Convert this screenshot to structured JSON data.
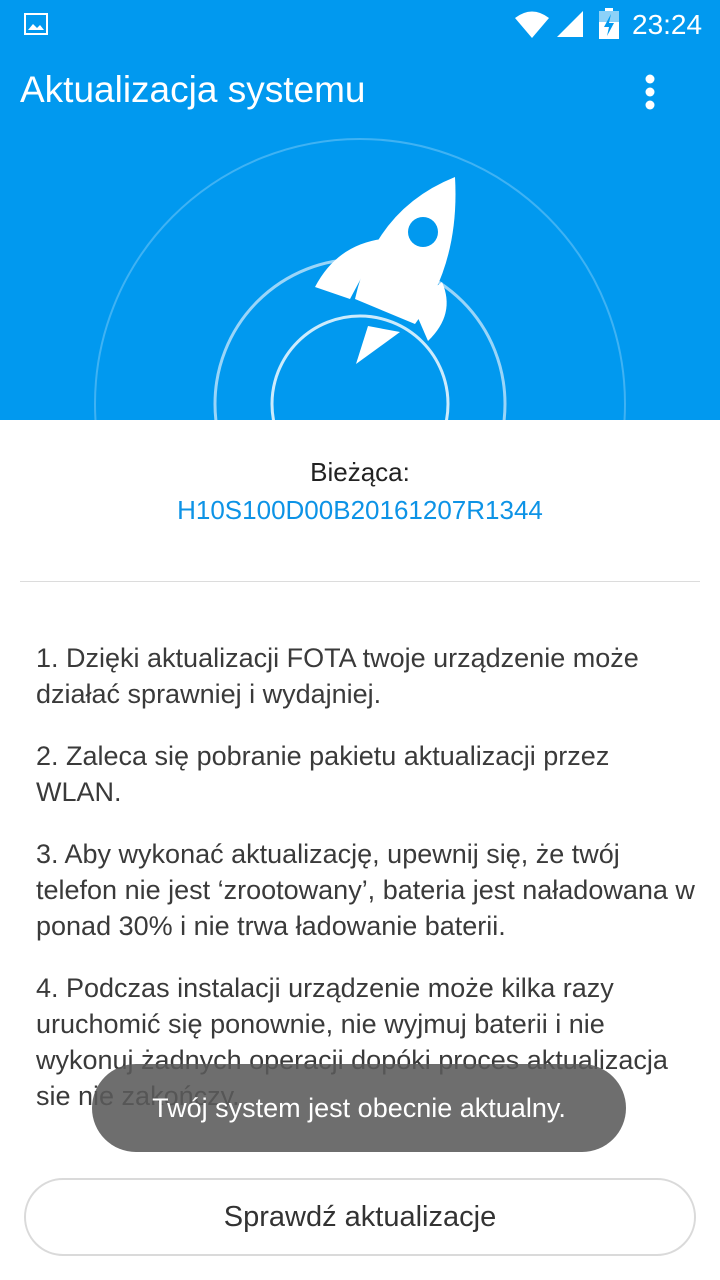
{
  "status_bar": {
    "time": "23:24",
    "icons": [
      "image-notification-icon",
      "wifi-icon",
      "cell-signal-icon",
      "battery-charging-icon"
    ]
  },
  "app_bar": {
    "title": "Aktualizacja systemu",
    "menu_icon": "more-vert-icon"
  },
  "hero": {
    "icon": "rocket-icon"
  },
  "current_version": {
    "label": "Bieżąca:",
    "value": "H10S100D00B20161207R1344"
  },
  "notes": [
    "1. Dzięki aktualizacji FOTA twoje urządzenie może działać sprawniej i wydajniej.",
    "2. Zaleca się pobranie pakietu aktualizacji przez WLAN.",
    "3. Aby wykonać aktualizację, upewnij się, że twój telefon nie jest ‘zrootowany’, bateria jest naładowana w ponad 30% i nie trwa ładowanie baterii.",
    "4. Podczas instalacji urządzenie może kilka razy uruchomić się ponownie, nie wyjmuj baterii i nie wykonuj żadnych operacji dopóki proces aktualizacja sie nie zakończy."
  ],
  "toast": {
    "text": "Twój system jest obecnie aktualny."
  },
  "check_button": {
    "label": "Sprawdź aktualizacje"
  },
  "colors": {
    "primary": "#0199ef",
    "version_text": "#0d93e6",
    "toast_bg": "#5a5a5a"
  }
}
